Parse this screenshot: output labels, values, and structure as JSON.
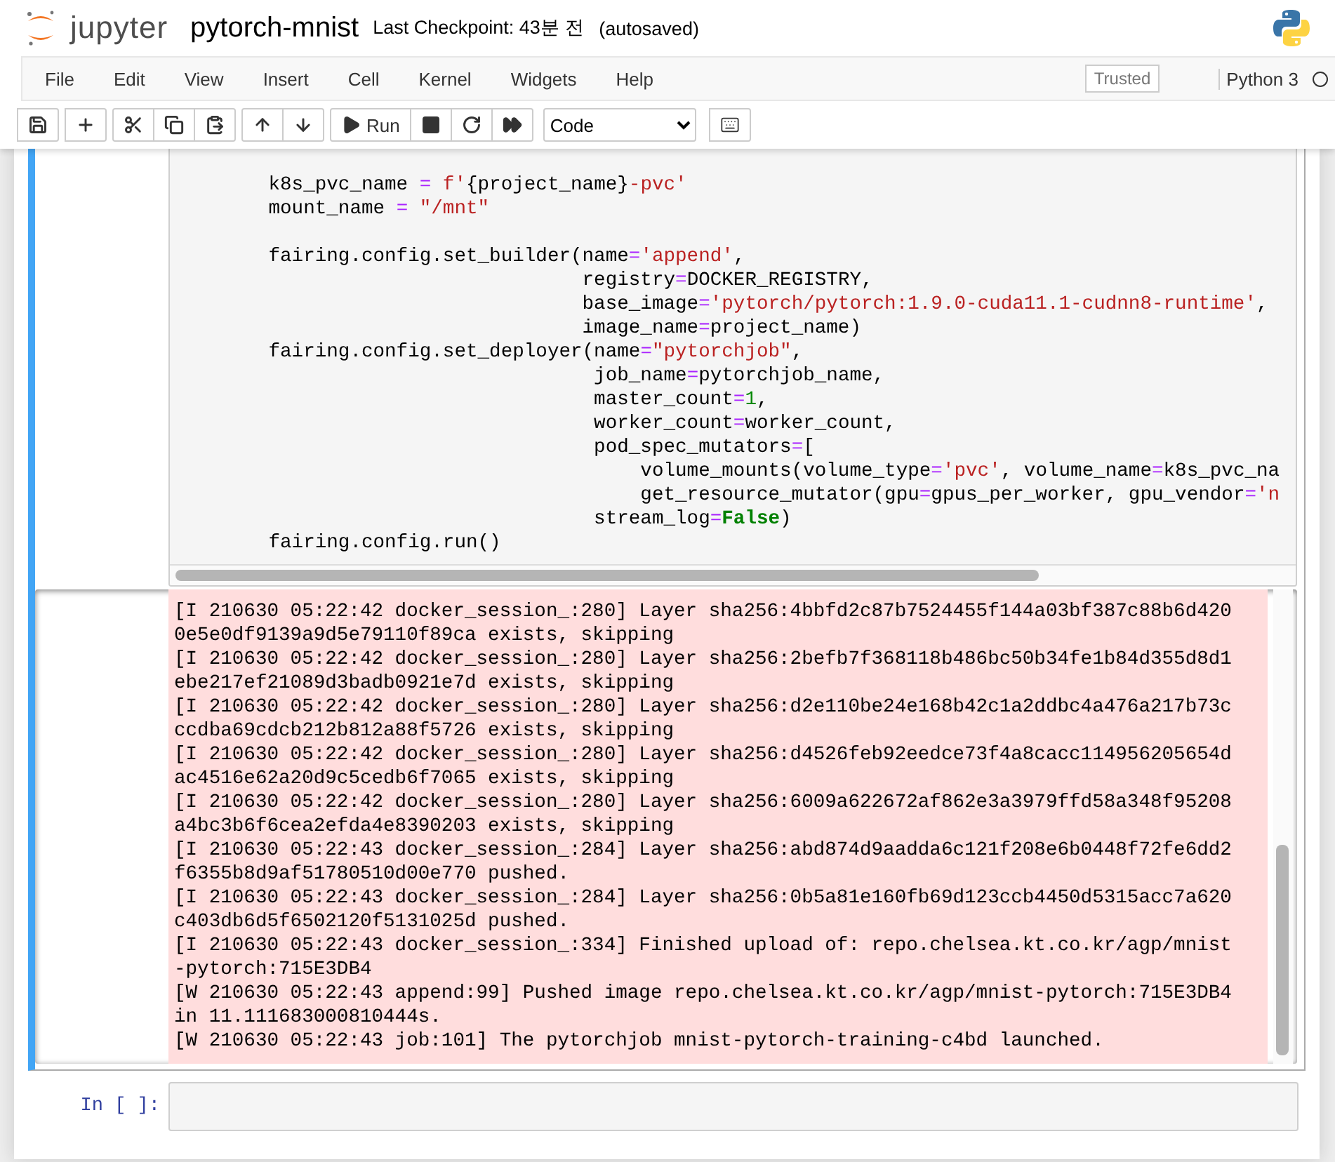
{
  "header": {
    "logo_text": "jupyter",
    "notebook_name": "pytorch-mnist",
    "checkpoint": "Last Checkpoint: 43분 전",
    "autosave": "(autosaved)"
  },
  "menu": {
    "items": [
      "File",
      "Edit",
      "View",
      "Insert",
      "Cell",
      "Kernel",
      "Widgets",
      "Help"
    ],
    "trusted": "Trusted",
    "kernel": "Python 3",
    "kernel_busy": false
  },
  "toolbar": {
    "run_label": "Run",
    "cell_type": "Code"
  },
  "active_cell": {
    "selected": true,
    "code_blocks": [
      [
        [
          {
            "kind": "name",
            "text": "        k8s_pvc_name "
          },
          {
            "kind": "operator",
            "text": "="
          },
          {
            "kind": "string",
            "text": " f'"
          },
          {
            "kind": "name",
            "text": "{project_name}"
          },
          {
            "kind": "string",
            "text": "-pvc'"
          }
        ],
        [
          {
            "kind": "name",
            "text": "        mount_name "
          },
          {
            "kind": "operator",
            "text": "="
          },
          {
            "kind": "string",
            "text": " \"/mnt\""
          }
        ]
      ],
      [
        [
          {
            "kind": "name",
            "text": "        fairing.config.set_builder(name"
          },
          {
            "kind": "operator",
            "text": "="
          },
          {
            "kind": "string",
            "text": "'append'"
          },
          {
            "kind": "name",
            "text": ","
          }
        ],
        [
          {
            "kind": "name",
            "text": "                                   registry"
          },
          {
            "kind": "operator",
            "text": "="
          },
          {
            "kind": "name",
            "text": "DOCKER_REGISTRY,"
          }
        ],
        [
          {
            "kind": "name",
            "text": "                                   base_image"
          },
          {
            "kind": "operator",
            "text": "="
          },
          {
            "kind": "string",
            "text": "'pytorch/pytorch:1.9.0-cuda11.1-cudnn8-runtime'"
          },
          {
            "kind": "name",
            "text": ","
          }
        ],
        [
          {
            "kind": "name",
            "text": "                                   image_name"
          },
          {
            "kind": "operator",
            "text": "="
          },
          {
            "kind": "name",
            "text": "project_name)"
          }
        ],
        [
          {
            "kind": "name",
            "text": "        fairing.config.set_deployer(name"
          },
          {
            "kind": "operator",
            "text": "="
          },
          {
            "kind": "string",
            "text": "\"pytorchjob\""
          },
          {
            "kind": "name",
            "text": ","
          }
        ],
        [
          {
            "kind": "name",
            "text": "                                    job_name"
          },
          {
            "kind": "operator",
            "text": "="
          },
          {
            "kind": "name",
            "text": "pytorchjob_name,"
          }
        ],
        [
          {
            "kind": "name",
            "text": "                                    master_count"
          },
          {
            "kind": "operator",
            "text": "="
          },
          {
            "kind": "number",
            "text": "1"
          },
          {
            "kind": "name",
            "text": ","
          }
        ],
        [
          {
            "kind": "name",
            "text": "                                    worker_count"
          },
          {
            "kind": "operator",
            "text": "="
          },
          {
            "kind": "name",
            "text": "worker_count,"
          }
        ],
        [
          {
            "kind": "name",
            "text": "                                    pod_spec_mutators"
          },
          {
            "kind": "operator",
            "text": "="
          },
          {
            "kind": "name",
            "text": "["
          }
        ],
        [
          {
            "kind": "name",
            "text": "                                        volume_mounts(volume_type"
          },
          {
            "kind": "operator",
            "text": "="
          },
          {
            "kind": "string",
            "text": "'pvc'"
          },
          {
            "kind": "name",
            "text": ", volume_name"
          },
          {
            "kind": "operator",
            "text": "="
          },
          {
            "kind": "name",
            "text": "k8s_pvc_na"
          }
        ],
        [
          {
            "kind": "name",
            "text": "                                        get_resource_mutator(gpu"
          },
          {
            "kind": "operator",
            "text": "="
          },
          {
            "kind": "name",
            "text": "gpus_per_worker, gpu_vendor"
          },
          {
            "kind": "operator",
            "text": "="
          },
          {
            "kind": "string",
            "text": "'n"
          }
        ],
        [
          {
            "kind": "name",
            "text": "                                    stream_log"
          },
          {
            "kind": "operator",
            "text": "="
          },
          {
            "kind": "keyword",
            "text": "False"
          },
          {
            "kind": "name",
            "text": ")"
          }
        ],
        [
          {
            "kind": "name",
            "text": "        fairing.config.run()"
          }
        ]
      ]
    ],
    "output_lines": [
      "[I 210630 05:22:42 docker_session_:280] Layer sha256:4bbfd2c87b7524455f144a03bf387c88b6d420",
      "0e5e0df9139a9d5e79110f89ca exists, skipping",
      "[I 210630 05:22:42 docker_session_:280] Layer sha256:2befb7f368118b486bc50b34fe1b84d355d8d1",
      "ebe217ef21089d3badb0921e7d exists, skipping",
      "[I 210630 05:22:42 docker_session_:280] Layer sha256:d2e110be24e168b42c1a2ddbc4a476a217b73c",
      "ccdba69cdcb212b812a88f5726 exists, skipping",
      "[I 210630 05:22:42 docker_session_:280] Layer sha256:d4526feb92eedce73f4a8cacc114956205654d",
      "ac4516e62a20d9c5cedb6f7065 exists, skipping",
      "[I 210630 05:22:42 docker_session_:280] Layer sha256:6009a622672af862e3a3979ffd58a348f95208",
      "a4bc3b6f6cea2efda4e8390203 exists, skipping",
      "[I 210630 05:22:43 docker_session_:284] Layer sha256:abd874d9aadda6c121f208e6b0448f72fe6dd2",
      "f6355b8d9af51780510d00e770 pushed.",
      "[I 210630 05:22:43 docker_session_:284] Layer sha256:0b5a81e160fb69d123ccb4450d5315acc7a620",
      "c403db6d5f6502120f5131025d pushed.",
      "[I 210630 05:22:43 docker_session_:334] Finished upload of: repo.chelsea.kt.co.kr/agp/mnist",
      "-pytorch:715E3DB4",
      "[W 210630 05:22:43 append:99] Pushed image repo.chelsea.kt.co.kr/agp/mnist-pytorch:715E3DB4",
      "in 11.111683000810444s.",
      "[W 210630 05:22:43 job:101] The pytorchjob mnist-pytorch-training-c4bd launched."
    ]
  },
  "next_cell": {
    "prompt": "In [ ]:",
    "selected": false
  }
}
